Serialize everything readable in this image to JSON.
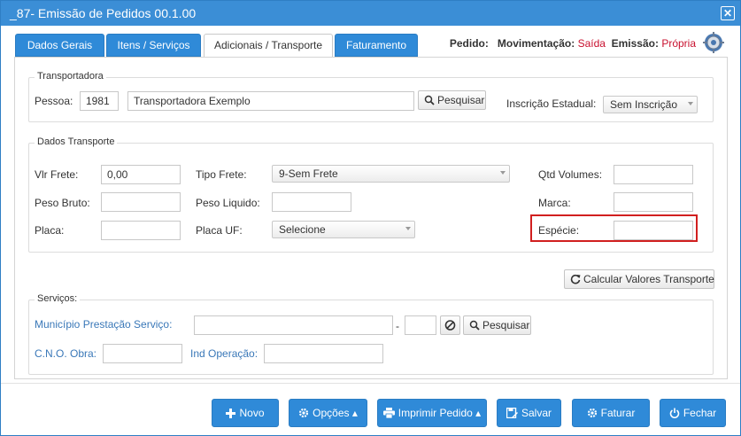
{
  "window": {
    "title": "_87- Emissão de Pedidos 00.1.00",
    "close_label": "✕"
  },
  "tabs": [
    {
      "label": "Dados Gerais"
    },
    {
      "label": "Itens / Serviços"
    },
    {
      "label": "Adicionais / Transporte"
    },
    {
      "label": "Faturamento"
    }
  ],
  "active_tab": "Adicionais / Transporte",
  "header": {
    "pedido_label": "Pedido:",
    "movimentacao_label": "Movimentação:",
    "movimentacao_value": "Saída",
    "emissao_label": "Emissão:",
    "emissao_value": "Própria"
  },
  "transportadora": {
    "legend": "Transportadora",
    "pessoa_label": "Pessoa:",
    "pessoa_code": "1981",
    "pessoa_name": "Transportadora Exemplo",
    "pesquisar_label": "Pesquisar",
    "inscricao_label": "Inscrição Estadual:",
    "inscricao_value": "Sem Inscrição"
  },
  "dados_transporte": {
    "legend": "Dados Transporte",
    "vlr_frete_label": "Vlr Frete:",
    "vlr_frete_value": "0,00",
    "tipo_frete_label": "Tipo Frete:",
    "tipo_frete_value": "9-Sem Frete",
    "qtd_volumes_label": "Qtd Volumes:",
    "qtd_volumes_value": "",
    "peso_bruto_label": "Peso Bruto:",
    "peso_bruto_value": "",
    "peso_liquido_label": "Peso Liquido:",
    "peso_liquido_value": "",
    "marca_label": "Marca:",
    "marca_value": "",
    "placa_label": "Placa:",
    "placa_value": "",
    "placa_uf_label": "Placa UF:",
    "placa_uf_value": "Selecione",
    "especie_label": "Espécie:",
    "especie_value": ""
  },
  "calcular_label": "Calcular Valores Transporte",
  "servicos": {
    "legend": "Serviços:",
    "municipio_label": "Município Prestação Serviço:",
    "municipio_code": "",
    "municipio_value": "",
    "dash": "-",
    "pesquisar_label": "Pesquisar",
    "cno_label": "C.N.O. Obra:",
    "cno_value": "",
    "ind_operacao_label": "Ind Operação:",
    "ind_operacao_value": ""
  },
  "footer": {
    "novo": "Novo",
    "opcoes": "Opções",
    "imprimir": "Imprimir Pedido",
    "salvar": "Salvar",
    "faturar": "Faturar",
    "fechar": "Fechar"
  },
  "colors": {
    "accent": "#2f8ad8",
    "titlebar": "#3b8ed6",
    "highlight": "#d11f1f",
    "status_red": "#c8102e"
  }
}
